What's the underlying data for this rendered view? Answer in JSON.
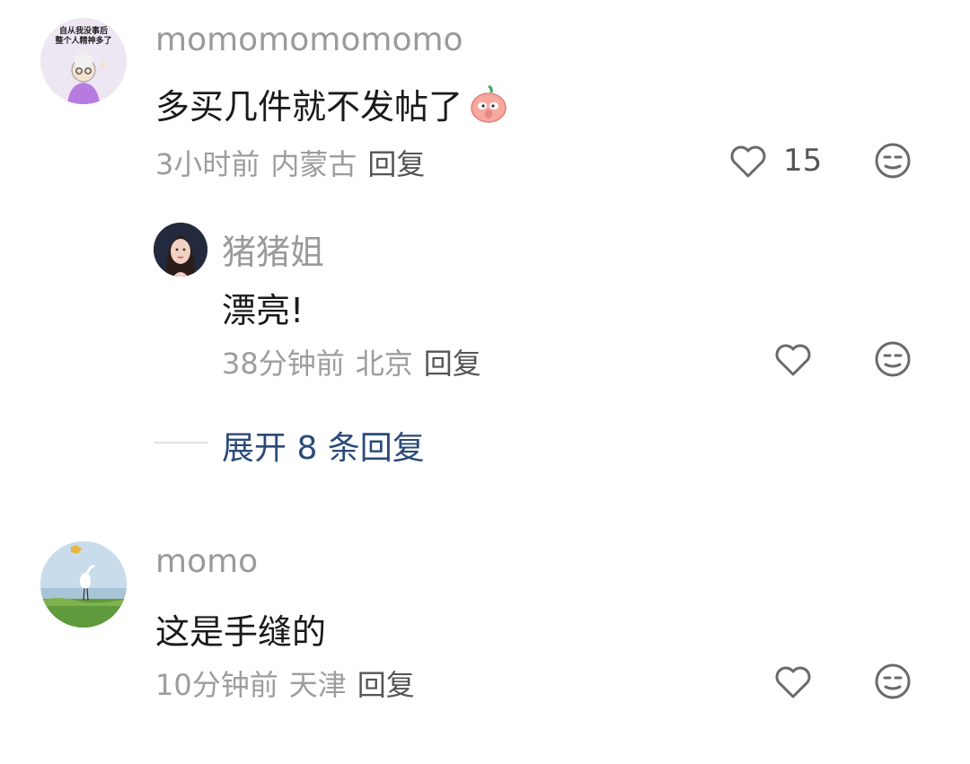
{
  "comments": [
    {
      "username": "momomomomomo",
      "avatar_text_line1": "自从我没事后",
      "avatar_text_line2": "整个人精神多了",
      "text": "多买几件就不发帖了",
      "emoji": "shy-peach-emoji",
      "time": "3小时前",
      "location": "内蒙古",
      "reply_label": "回复",
      "like_count": "15",
      "replies": [
        {
          "username": "猪猪姐",
          "text": "漂亮!",
          "time": "38分钟前",
          "location": "北京",
          "reply_label": "回复"
        }
      ],
      "expand_label": "展开 8 条回复"
    },
    {
      "username": "momo",
      "text": "这是手缝的",
      "time": "10分钟前",
      "location": "天津",
      "reply_label": "回复"
    }
  ],
  "colors": {
    "username": "#9a9a9a",
    "body_text": "#1a1a1a",
    "meta": "#9d9d9d",
    "expand_link": "#2b4a78",
    "icon": "#6a6a6a"
  }
}
